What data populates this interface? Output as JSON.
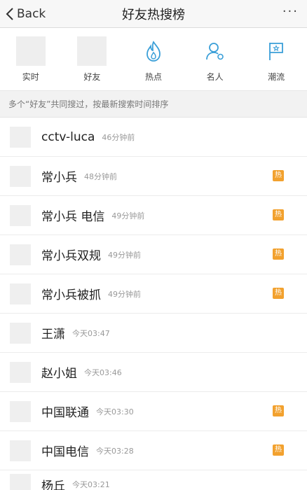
{
  "navbar": {
    "back_label": "Back",
    "title": "好友热搜榜",
    "more": "···"
  },
  "tabs": [
    {
      "label": "实时",
      "icon": "placeholder"
    },
    {
      "label": "好友",
      "icon": "placeholder"
    },
    {
      "label": "热点",
      "icon": "flame-icon"
    },
    {
      "label": "名人",
      "icon": "person-icon"
    },
    {
      "label": "潮流",
      "icon": "flag-icon"
    }
  ],
  "colors": {
    "accent": "#3a9fd8",
    "hot_badge": "#f2a12e"
  },
  "info": {
    "text": "多个“好友”共同搜过，按最新搜索时间排序"
  },
  "hot_badge_label": "热",
  "items": [
    {
      "name": "cctv-luca",
      "time": "46分钟前",
      "hot": false
    },
    {
      "name": "常小兵",
      "time": "48分钟前",
      "hot": true
    },
    {
      "name": "常小兵 电信",
      "time": "49分钟前",
      "hot": true
    },
    {
      "name": "常小兵双规",
      "time": "49分钟前",
      "hot": true
    },
    {
      "name": "常小兵被抓",
      "time": "49分钟前",
      "hot": true
    },
    {
      "name": "王潇",
      "time": "今天03:47",
      "hot": false
    },
    {
      "name": "赵小姐",
      "time": "今天03:46",
      "hot": false
    },
    {
      "name": "中国联通",
      "time": "今天03:30",
      "hot": true
    },
    {
      "name": "中国电信",
      "time": "今天03:28",
      "hot": true
    },
    {
      "name": "杨丘",
      "time": "今天03:21",
      "hot": false
    }
  ]
}
